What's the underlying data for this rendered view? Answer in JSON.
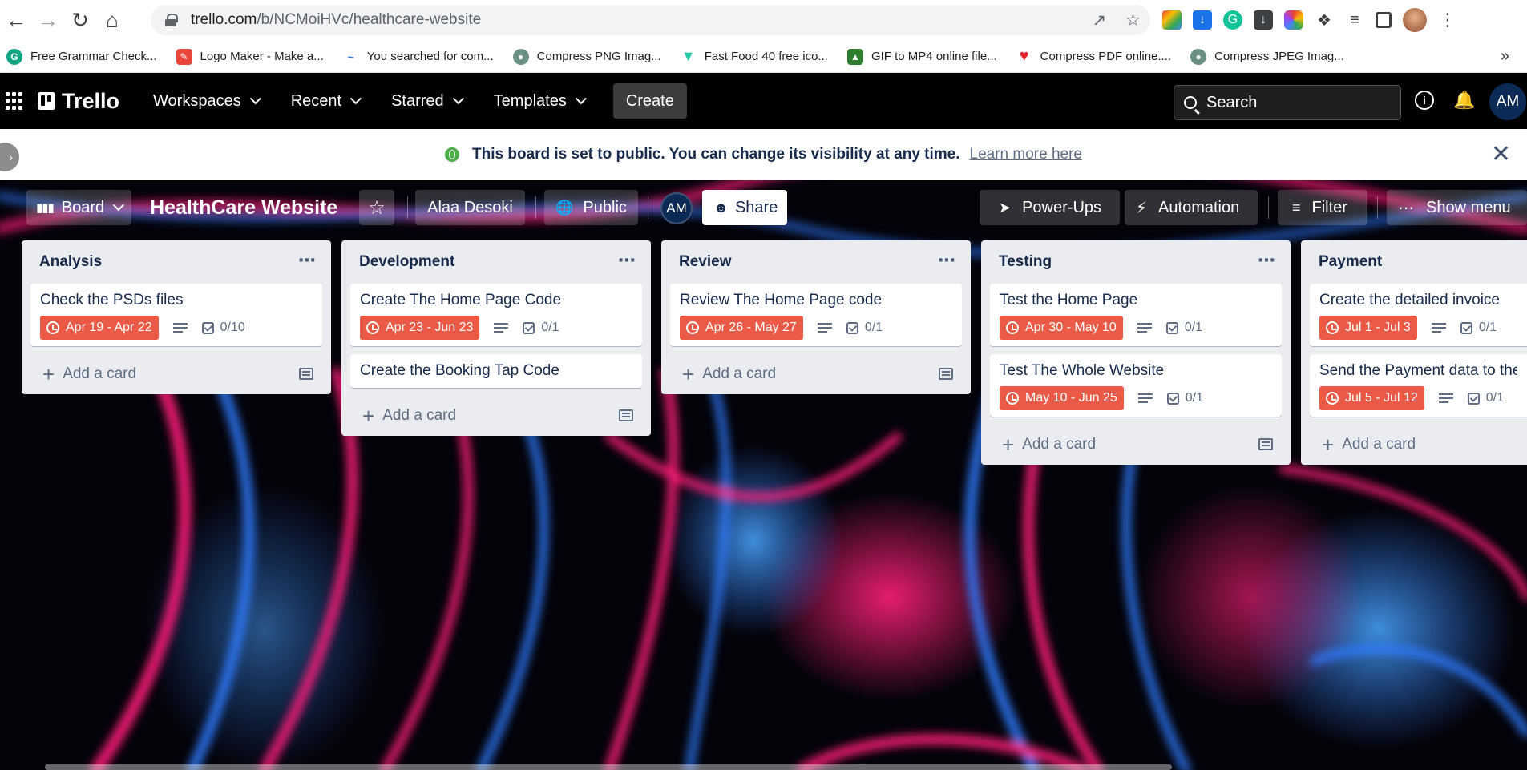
{
  "browser": {
    "url_host": "trello.com",
    "url_path": "/b/NCMoiHVc/healthcare-website",
    "bookmarks": [
      {
        "label": "Free Grammar Check...",
        "icon": "grammar-icon",
        "color": "#11a683"
      },
      {
        "label": "Logo Maker - Make a...",
        "icon": "logo-maker-icon",
        "color": "#e8463a"
      },
      {
        "label": "You searched for com...",
        "icon": "search-site-icon",
        "color": "#3a7bd5"
      },
      {
        "label": "Compress PNG Imag...",
        "icon": "panda-icon",
        "color": "#6a8f84"
      },
      {
        "label": "Fast Food 40 free ico...",
        "icon": "flaticon-icon",
        "color": "#1fc6a3"
      },
      {
        "label": "GIF to MP4 online file...",
        "icon": "gif-icon",
        "color": "#2f7d2f"
      },
      {
        "label": "Compress PDF online....",
        "icon": "heart-icon",
        "color": "#e5252a"
      },
      {
        "label": "Compress JPEG Imag...",
        "icon": "panda-icon",
        "color": "#6a8f84"
      }
    ],
    "more_bookmarks": "»"
  },
  "trello": {
    "logo": "Trello",
    "nav": [
      {
        "label": "Workspaces"
      },
      {
        "label": "Recent"
      },
      {
        "label": "Starred"
      },
      {
        "label": "Templates"
      }
    ],
    "create_label": "Create",
    "search_placeholder": "Search",
    "avatar_initials": "AM"
  },
  "banner": {
    "message": "This board is set to public. You can change its visibility at any time.",
    "link": "Learn more here",
    "close": "✕"
  },
  "board": {
    "view_label": "Board",
    "title": "HealthCare Website",
    "workspace": "Alaa Desoki",
    "visibility": "Public",
    "member_initials": "AM",
    "share_label": "Share",
    "powerups_label": "Power-Ups",
    "automation_label": "Automation",
    "filter_label": "Filter",
    "show_menu_label": "Show menu"
  },
  "lists": [
    {
      "title": "Analysis",
      "cards": [
        {
          "title": "Check the PSDs files",
          "due": "Apr 19 - Apr 22",
          "checklist": "0/10"
        }
      ],
      "add_card": "Add a card"
    },
    {
      "title": "Development",
      "cards": [
        {
          "title": "Create The Home Page Code",
          "due": "Apr 23 - Jun 23",
          "checklist": "0/1"
        },
        {
          "title": "Create the Booking Tap Code"
        }
      ],
      "add_card": "Add a card"
    },
    {
      "title": "Review",
      "cards": [
        {
          "title": "Review The Home Page code",
          "due": "Apr 26 - May 27",
          "checklist": "0/1"
        }
      ],
      "add_card": "Add a card"
    },
    {
      "title": "Testing",
      "cards": [
        {
          "title": "Test the Home Page",
          "due": "Apr 30 - May 10",
          "checklist": "0/1"
        },
        {
          "title": "Test The Whole Website",
          "due": "May 10 - Jun 25",
          "checklist": "0/1"
        }
      ],
      "add_card": "Add a card"
    },
    {
      "title": "Payment",
      "cards": [
        {
          "title": "Create the detailed invoice",
          "due": "Jul 1 - Jul 3",
          "checklist": "0/1"
        },
        {
          "title": "Send the Payment data to the",
          "due": "Jul 5 - Jul 12",
          "checklist": "0/1"
        }
      ],
      "add_card": "Add a card"
    }
  ],
  "colors": {
    "due_badge": "#eb5a46",
    "list_bg": "#ebecf0",
    "accent_pink": "#ff1f7a",
    "accent_blue": "#2f7bff"
  }
}
